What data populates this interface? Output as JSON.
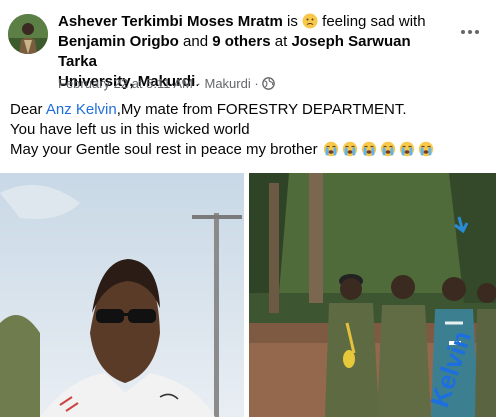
{
  "post": {
    "author": "Ashever Terkimbi Moses Mratm",
    "is_word": "is",
    "feeling": "feeling sad with",
    "tagged_person": "Benjamin Origbo",
    "and_word": "and",
    "others": "9 others",
    "at_word": "at",
    "location_line1": "Joseph Sarwuan Tarka",
    "location_line2": "University, Makurdi",
    "period": ".",
    "date": "February 22 at 5:11 AM",
    "sep": "·",
    "place": "Makurdi",
    "sep2": "·",
    "body": {
      "dear": "Dear",
      "mention": "Anz Kelvin",
      "line1_rest": ",My mate from FORESTRY DEPARTMENT.",
      "line2": "You have left us in this wicked world",
      "line3": "May your Gentle soul rest in peace my brother"
    },
    "crying_emoji_count": 6
  },
  "photos": {
    "right_annotation": "Kelvin"
  },
  "icons": {
    "sad_face": "sad-face-icon",
    "globe": "globe-icon",
    "more": "more-options-icon",
    "crying": "crying-face-icon"
  },
  "colors": {
    "link": "#216fdb",
    "meta": "#65676b",
    "text": "#050505"
  }
}
